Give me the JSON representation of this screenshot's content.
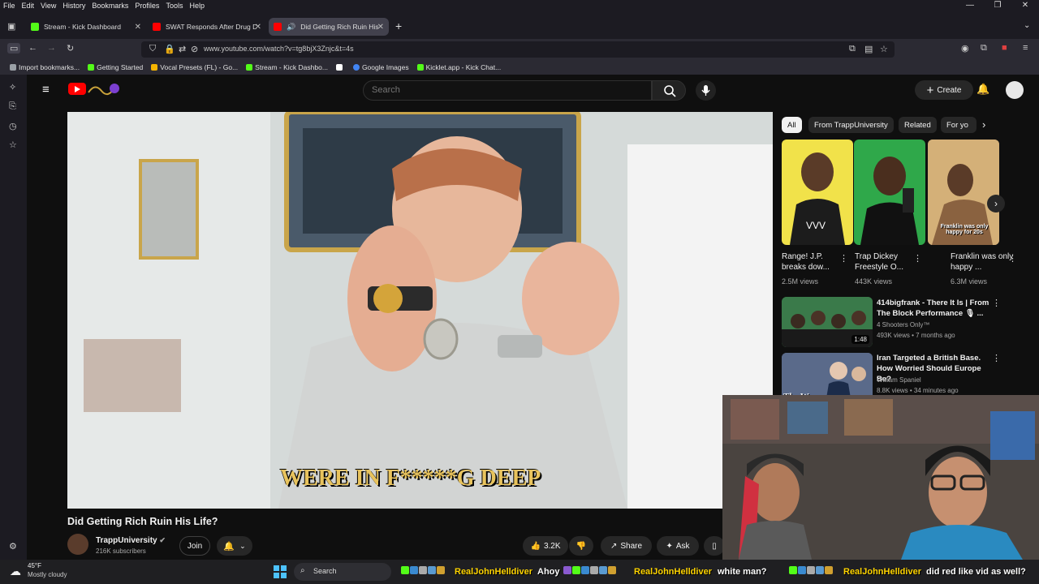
{
  "menubar": {
    "items": [
      "File",
      "Edit",
      "View",
      "History",
      "Bookmarks",
      "Profiles",
      "Tools",
      "Help"
    ]
  },
  "tabs": [
    {
      "title": "Stream - Kick Dashboard",
      "favicon_color": "#53fc18"
    },
    {
      "title": "SWAT Responds After Drug Dea",
      "favicon_color": "#ff0000"
    },
    {
      "title": "Did Getting Rich Ruin His L",
      "favicon_color": "#ff0000"
    }
  ],
  "address_bar": {
    "url": "www.youtube.com/watch?v=tg8bjX3Znjc&t=4s"
  },
  "bookmarks": [
    {
      "label": "Import bookmarks...",
      "color": "#9aa0a6"
    },
    {
      "label": "Getting Started",
      "color": "#53fc18"
    },
    {
      "label": "Vocal Presets (FL) - Go...",
      "color": "#f4b400"
    },
    {
      "label": "Stream - Kick Dashbo...",
      "color": "#53fc18"
    },
    {
      "label": "",
      "color": "#ffffff"
    },
    {
      "label": "Google Images",
      "color": "#4285f4"
    },
    {
      "label": "Kicklet.app - Kick Chat...",
      "color": "#53fc18"
    }
  ],
  "youtube": {
    "search_placeholder": "Search",
    "create_label": "Create",
    "video": {
      "caption": "WERE IN F*****G DEEP",
      "title": "Did Getting Rich Ruin His Life?",
      "channel": "TrappUniversity",
      "subscribers": "216K subscribers",
      "join_label": "Join",
      "likes": "3.2K",
      "share_label": "Share",
      "ask_label": "Ask"
    },
    "chips": [
      "All",
      "From TrappUniversity",
      "Related",
      "For yo"
    ],
    "shorts": [
      {
        "title": "Range! J.P. breaks dow...",
        "views": "2.5M views",
        "overlay": ""
      },
      {
        "title": "Trap Dickey Freestyle O...",
        "views": "443K views",
        "overlay": ""
      },
      {
        "title": "Franklin was only happy ...",
        "views": "6.3M views",
        "overlay": "Franklin was only happy for 20s"
      }
    ],
    "recommended": [
      {
        "title": "414bigfrank - There It Is | From The Block Performance 🎙 ...",
        "channel": "4 Shooters Only™",
        "meta": "493K views • 7 months ago",
        "duration": "1:48"
      },
      {
        "title": "Iran Targeted a British Base. How Worried Should Europe Be?",
        "channel": "William Spaniel",
        "meta": "8.8K views • 34 minutes ago",
        "overlay": "The War"
      }
    ]
  },
  "taskbar": {
    "temp": "45°F",
    "weather": "Mostly cloudy",
    "search_label": "Search"
  },
  "chat": [
    {
      "name": "RealJohnHelldiver",
      "message": "Ahoy"
    },
    {
      "name": "RealJohnHelldiver",
      "message": "white man?"
    },
    {
      "name": "RealJohnHelldiver",
      "message": "did red like vid as well?"
    }
  ]
}
